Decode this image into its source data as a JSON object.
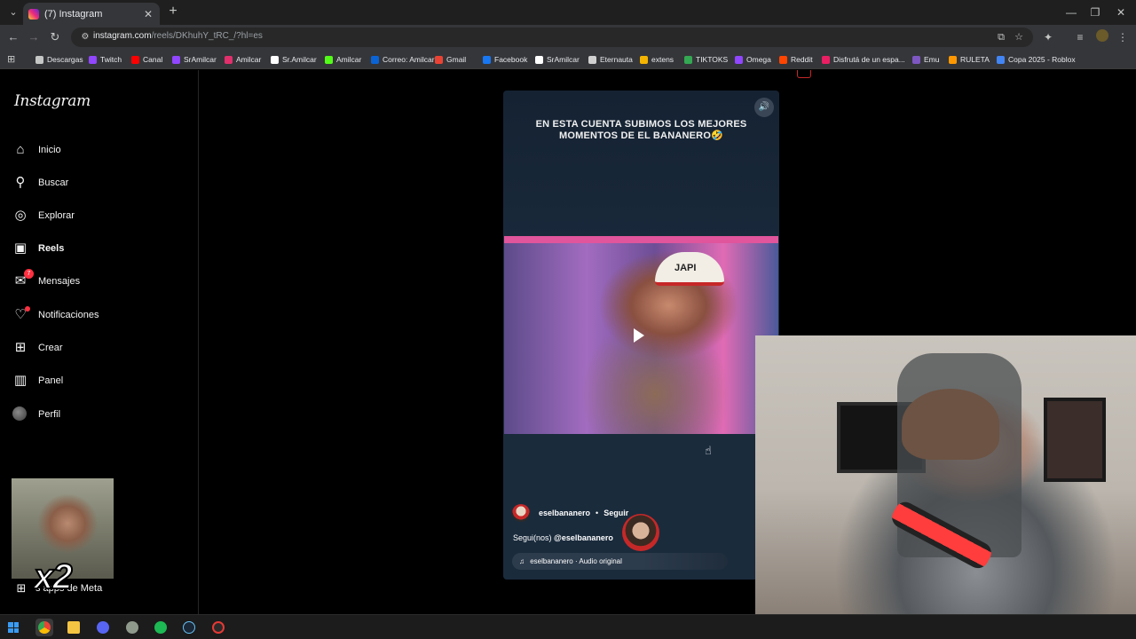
{
  "browser": {
    "tab_title": "(7) Instagram",
    "tab_close": "✕",
    "new_tab": "+",
    "url_main": "instagram.com",
    "url_path": "/reels/DKhuhY_tRC_/?hl=es",
    "bookmarks": [
      {
        "label": "Descargas",
        "color": "#c4c7c5"
      },
      {
        "label": "Twitch",
        "color": "#9146ff"
      },
      {
        "label": "Canal",
        "color": "#ff0000"
      },
      {
        "label": "SrAmilcar",
        "color": "#9146ff"
      },
      {
        "label": "Amilcar",
        "color": "#e1306c"
      },
      {
        "label": "Sr.Amilcar",
        "color": "#ffffff"
      },
      {
        "label": "Amilcar",
        "color": "#53fc18"
      },
      {
        "label": "Correo: Amilcar",
        "color": "#0a64d6"
      },
      {
        "label": "Gmail",
        "color": "#ea4335"
      },
      {
        "label": "Facebook",
        "color": "#1877f2"
      },
      {
        "label": "SrAmilcar",
        "color": "#ffffff"
      },
      {
        "label": "Eternauta",
        "color": "#d0d0d0"
      },
      {
        "label": "extens",
        "color": "#f4b400"
      },
      {
        "label": "TIKTOKS",
        "color": "#34a853"
      },
      {
        "label": "Omega",
        "color": "#9146ff"
      },
      {
        "label": "Reddit",
        "color": "#ff4500"
      },
      {
        "label": "Disfrutá de un espa...",
        "color": "#e91e63"
      },
      {
        "label": "Emu",
        "color": "#7e57c2"
      },
      {
        "label": "RULETA",
        "color": "#ff9800"
      },
      {
        "label": "Copa 2025 - Roblox",
        "color": "#4285f4"
      }
    ]
  },
  "instagram": {
    "logo": "Instagram",
    "nav": [
      {
        "label": "Inicio",
        "icon": "home-icon"
      },
      {
        "label": "Buscar",
        "icon": "search-icon"
      },
      {
        "label": "Explorar",
        "icon": "compass-icon"
      },
      {
        "label": "Reels",
        "icon": "reels-icon"
      },
      {
        "label": "Mensajes",
        "icon": "messenger-icon"
      },
      {
        "label": "Notificaciones",
        "icon": "heart-icon"
      },
      {
        "label": "Crear",
        "icon": "plus-square-icon"
      },
      {
        "label": "Panel",
        "icon": "bar-chart-icon"
      },
      {
        "label": "Perfil",
        "icon": "avatar"
      }
    ],
    "messages_badge": "7",
    "meta_label": "s apps de Meta",
    "reel": {
      "caption_line1": "EN ESTA CUENTA SUBIMOS LOS MEJORES",
      "caption_line2": "MOMENTOS DE  EL BANANERO🤣",
      "hat_text": "JAPI",
      "username": "eselbananero",
      "separator": "•",
      "follow": "Seguir",
      "description_prefix": "Segui(nos)",
      "description_mention": "@eselbananero",
      "audio": "eselbananero · Audio original"
    }
  },
  "overlay": {
    "multiplier": "x2"
  }
}
